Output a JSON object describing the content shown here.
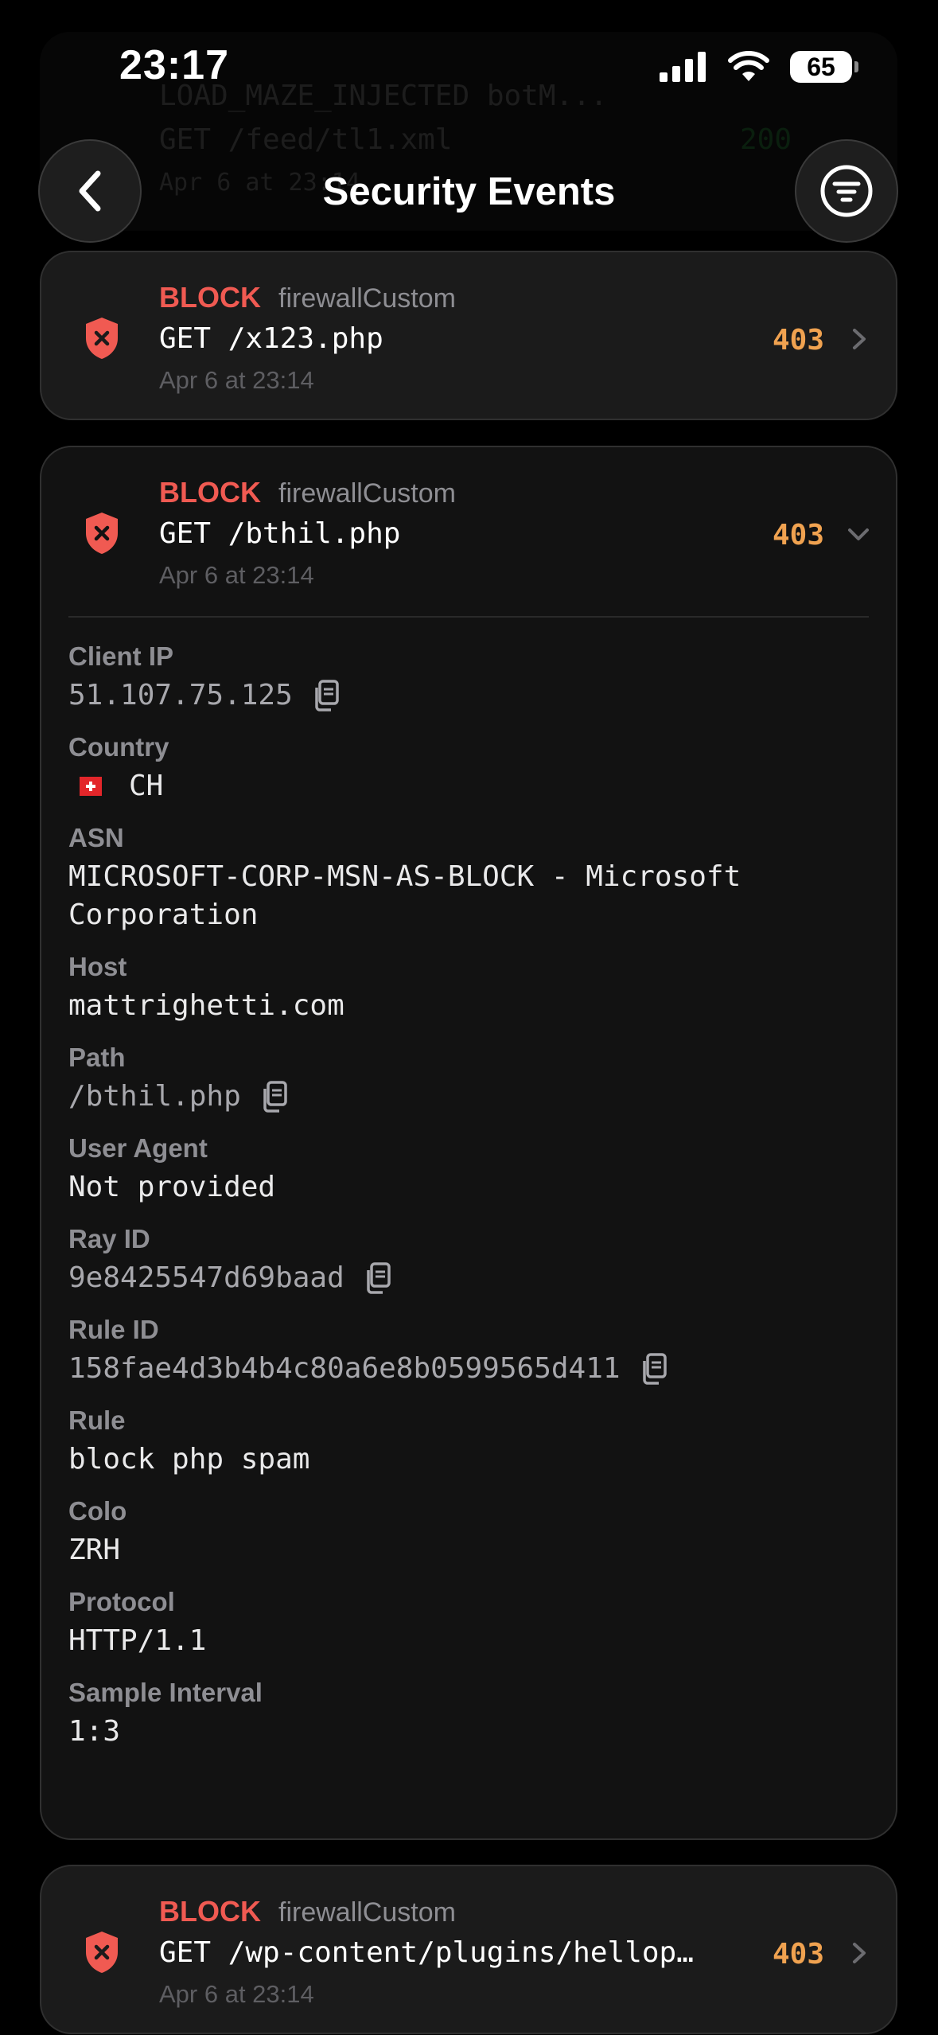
{
  "status_bar": {
    "time": "23:17",
    "battery": "65"
  },
  "header": {
    "title": "Security Events"
  },
  "ghost": {
    "line1": "LOAD_MAZE_INJECTED",
    "line1b": "botM...",
    "line2": "GET /feed/tl1.xml",
    "line2_status": "200",
    "line3": "Apr 6 at 23:14"
  },
  "events": [
    {
      "action": "BLOCK",
      "source": "firewallCustom",
      "request": "GET /x123.php",
      "time": "Apr 6 at 23:14",
      "status": "403"
    },
    {
      "action": "BLOCK",
      "source": "firewallCustom",
      "request": "GET /bthil.php",
      "time": "Apr 6 at 23:14",
      "status": "403"
    },
    {
      "action": "BLOCK",
      "source": "firewallCustom",
      "request": "GET /wp-content/plugins/hellop…",
      "time": "Apr 6 at 23:14",
      "status": "403"
    }
  ],
  "details": {
    "client_ip": {
      "label": "Client IP",
      "value": "51.107.75.125"
    },
    "country": {
      "label": "Country",
      "value": "CH"
    },
    "asn": {
      "label": "ASN",
      "value": "MICROSOFT-CORP-MSN-AS-BLOCK - Microsoft Corporation"
    },
    "host": {
      "label": "Host",
      "value": "mattrighetti.com"
    },
    "path": {
      "label": "Path",
      "value": "/bthil.php"
    },
    "user_agent": {
      "label": "User Agent",
      "value": "Not provided"
    },
    "ray_id": {
      "label": "Ray ID",
      "value": "9e8425547d69baad"
    },
    "rule_id": {
      "label": "Rule ID",
      "value": "158fae4d3b4b4c80a6e8b0599565d411"
    },
    "rule": {
      "label": "Rule",
      "value": "block php spam"
    },
    "colo": {
      "label": "Colo",
      "value": "ZRH"
    },
    "protocol": {
      "label": "Protocol",
      "value": "HTTP/1.1"
    },
    "sample_interval": {
      "label": "Sample Interval",
      "value": "1:3"
    }
  },
  "colors": {
    "block": "#f05a52",
    "status": "#f0a250",
    "background": "#000000",
    "card": "#1b1b1b"
  },
  "icons": [
    "chevron-left-icon",
    "filter-icon",
    "shield-x-icon",
    "chevron-right-icon",
    "chevron-down-icon",
    "copy-icon",
    "swiss-flag-icon",
    "signal-icon",
    "wifi-icon",
    "battery-icon"
  ]
}
